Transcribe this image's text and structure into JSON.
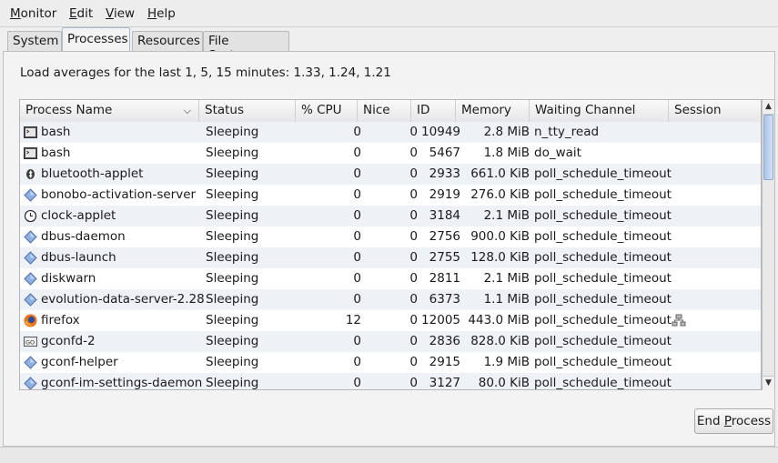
{
  "menu": [
    {
      "label": "Monitor",
      "accel": "M",
      "rest": "onitor"
    },
    {
      "label": "Edit",
      "accel": "E",
      "rest": "dit"
    },
    {
      "label": "View",
      "accel": "V",
      "rest": "iew"
    },
    {
      "label": "Help",
      "accel": "H",
      "rest": "elp"
    }
  ],
  "tabs": [
    "System",
    "Processes",
    "Resources",
    "File Systems"
  ],
  "active_tab": "Processes",
  "load_averages": "Load averages for the last 1, 5, 15 minutes: 1.33, 1.24, 1.21",
  "columns": [
    "Process Name",
    "Status",
    "% CPU",
    "Nice",
    "ID",
    "Memory",
    "Waiting Channel",
    "Session"
  ],
  "rows": [
    {
      "name": "bash",
      "icon": "terminal-icon",
      "status": "Sleeping",
      "cpu": "0",
      "nice": "0",
      "id": "10949",
      "memory": "2.8 MiB",
      "wait": "n_tty_read",
      "session": ""
    },
    {
      "name": "bash",
      "icon": "terminal-icon",
      "status": "Sleeping",
      "cpu": "0",
      "nice": "0",
      "id": "5467",
      "memory": "1.8 MiB",
      "wait": "do_wait",
      "session": ""
    },
    {
      "name": "bluetooth-applet",
      "icon": "bluetooth-icon",
      "status": "Sleeping",
      "cpu": "0",
      "nice": "0",
      "id": "2933",
      "memory": "661.0 KiB",
      "wait": "poll_schedule_timeout",
      "session": ""
    },
    {
      "name": "bonobo-activation-server",
      "icon": "diamond-icon",
      "status": "Sleeping",
      "cpu": "0",
      "nice": "0",
      "id": "2919",
      "memory": "276.0 KiB",
      "wait": "poll_schedule_timeout",
      "session": ""
    },
    {
      "name": "clock-applet",
      "icon": "clock-icon",
      "status": "Sleeping",
      "cpu": "0",
      "nice": "0",
      "id": "3184",
      "memory": "2.1 MiB",
      "wait": "poll_schedule_timeout",
      "session": ""
    },
    {
      "name": "dbus-daemon",
      "icon": "diamond-icon",
      "status": "Sleeping",
      "cpu": "0",
      "nice": "0",
      "id": "2756",
      "memory": "900.0 KiB",
      "wait": "poll_schedule_timeout",
      "session": ""
    },
    {
      "name": "dbus-launch",
      "icon": "diamond-icon",
      "status": "Sleeping",
      "cpu": "0",
      "nice": "0",
      "id": "2755",
      "memory": "128.0 KiB",
      "wait": "poll_schedule_timeout",
      "session": ""
    },
    {
      "name": "diskwarn",
      "icon": "diamond-icon",
      "status": "Sleeping",
      "cpu": "0",
      "nice": "0",
      "id": "2811",
      "memory": "2.1 MiB",
      "wait": "poll_schedule_timeout",
      "session": ""
    },
    {
      "name": "evolution-data-server-2.28",
      "icon": "diamond-icon",
      "status": "Sleeping",
      "cpu": "0",
      "nice": "0",
      "id": "6373",
      "memory": "1.1 MiB",
      "wait": "poll_schedule_timeout",
      "session": ""
    },
    {
      "name": "firefox",
      "icon": "firefox-icon",
      "status": "Sleeping",
      "cpu": "12",
      "nice": "0",
      "id": "12005",
      "memory": "443.0 MiB",
      "wait": "poll_schedule_timeout",
      "session": "network-icon"
    },
    {
      "name": "gconfd-2",
      "icon": "gconf-icon",
      "status": "Sleeping",
      "cpu": "0",
      "nice": "0",
      "id": "2836",
      "memory": "828.0 KiB",
      "wait": "poll_schedule_timeout",
      "session": ""
    },
    {
      "name": "gconf-helper",
      "icon": "diamond-icon",
      "status": "Sleeping",
      "cpu": "0",
      "nice": "0",
      "id": "2915",
      "memory": "1.9 MiB",
      "wait": "poll_schedule_timeout",
      "session": ""
    },
    {
      "name": "gconf-im-settings-daemon",
      "icon": "diamond-icon",
      "status": "Sleeping",
      "cpu": "0",
      "nice": "0",
      "id": "3127",
      "memory": "80.0 KiB",
      "wait": "poll_schedule_timeout",
      "session": ""
    }
  ],
  "end_process": {
    "label": "End Process",
    "accel": "P",
    "pre": "End ",
    "rest": "rocess"
  },
  "colors": {
    "accent": "#3a6fbf",
    "row_alt": "#eef1f6",
    "firefox": "#e8731e"
  }
}
